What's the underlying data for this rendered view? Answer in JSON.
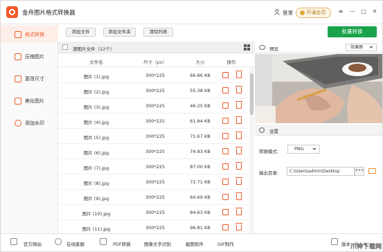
{
  "app": {
    "title": "金舟图片格式转换器"
  },
  "header": {
    "login": "登录",
    "vip": "开通会员",
    "controls": [
      "≡",
      "—",
      "□",
      "✕"
    ]
  },
  "sidebar": {
    "items": [
      {
        "label": "格式转换",
        "active": true
      },
      {
        "label": "压缩图片",
        "active": false
      },
      {
        "label": "更改尺寸",
        "active": false
      },
      {
        "label": "美化图片",
        "active": false
      },
      {
        "label": "添加水印",
        "active": false
      }
    ]
  },
  "toolbar": {
    "add_file": "添加文件",
    "add_folder": "添加文件夹",
    "clear_list": "清除列表",
    "batch_convert": "批量转换"
  },
  "list": {
    "source_label": "源图片文件（12个）",
    "columns": [
      "文件名",
      "尺寸（px）",
      "大小",
      "操作"
    ],
    "rows": [
      {
        "name": "图片 (1).jpg",
        "size": "300*225",
        "filesize": "66.86 KB"
      },
      {
        "name": "图片 (2).jpg",
        "size": "300*225",
        "filesize": "55.38 KB"
      },
      {
        "name": "图片 (3).jpg",
        "size": "300*225",
        "filesize": "46.25 KB"
      },
      {
        "name": "图片 (4).jpg",
        "size": "300*225",
        "filesize": "61.84 KB"
      },
      {
        "name": "图片 (5).jpg",
        "size": "300*225",
        "filesize": "71.67 KB"
      },
      {
        "name": "图片 (6).jpg",
        "size": "300*225",
        "filesize": "74.83 KB"
      },
      {
        "name": "图片 (7).jpg",
        "size": "300*225",
        "filesize": "87.00 KB"
      },
      {
        "name": "图片 (8).jpg",
        "size": "300*225",
        "filesize": "72.71 KB"
      },
      {
        "name": "图片 (9).jpg",
        "size": "300*225",
        "filesize": "64.69 KB"
      },
      {
        "name": "图片 (10).jpg",
        "size": "300*225",
        "filesize": "84.63 KB"
      },
      {
        "name": "图片 (11).jpg",
        "size": "300*225",
        "filesize": "96.81 KB"
      }
    ]
  },
  "preview": {
    "label": "预览",
    "effect": "效果图"
  },
  "settings": {
    "label": "设置",
    "format_label": "转换模式:",
    "format_value": "PNG",
    "output_label": "输出目录:",
    "output_value": "C:\\Users\\admin\\Desktop",
    "more": "•••"
  },
  "statusbar": {
    "items": [
      "官方网站",
      "在线客服",
      "PDF转换",
      "图像文字识别",
      "截图软件",
      "GIF制作"
    ],
    "version": "版本：3.1.4"
  },
  "colors": {
    "accent": "#ef5a2a",
    "green": "#1aa34a"
  },
  "watermark": "爪神下载网"
}
